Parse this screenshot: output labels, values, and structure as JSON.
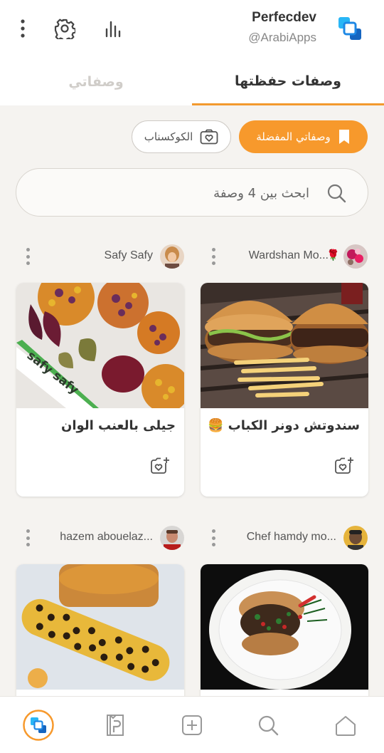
{
  "header": {
    "profile_name": "Perfecdev",
    "profile_handle": "@ArabiApps",
    "brand_color": "#1e88e5"
  },
  "tabs": [
    {
      "label": "وصفاتي",
      "active": false
    },
    {
      "label": "وصفات حفظتها",
      "active": true
    }
  ],
  "accent_color": "#f7992c",
  "filters": {
    "favorites_label": "وصفاتي المفضلة",
    "cooksnap_label": "الكوكسناب"
  },
  "search": {
    "placeholder": "ابحث بين 4 وصفة"
  },
  "recipes": [
    {
      "author": "Wardshan Mo...",
      "title": "سندوتش دونر الكباب 🍔",
      "image": "burger-photo"
    },
    {
      "author": "Safy Safy",
      "title": "جيلى بالعنب الوان",
      "image": "jelly-photo"
    },
    {
      "author": "Chef hamdy mo...",
      "title": "",
      "image": "plate-photo"
    },
    {
      "author": "hazem abouelaz...",
      "title": "",
      "image": "corn-photo"
    }
  ],
  "watermarks": {
    "jelly": "safy safy"
  },
  "bottom_nav": [
    {
      "name": "home",
      "icon": "home-icon"
    },
    {
      "name": "search",
      "icon": "search-icon"
    },
    {
      "name": "create",
      "icon": "add-box-icon"
    },
    {
      "name": "premium",
      "icon": "premium-book-icon"
    },
    {
      "name": "profile",
      "icon": "app-logo-icon",
      "active": true
    }
  ]
}
